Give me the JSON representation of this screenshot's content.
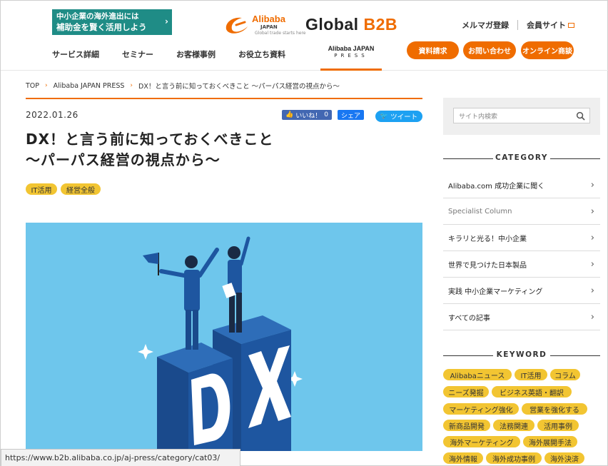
{
  "header": {
    "promo_line1": "中小企業の海外進出には",
    "promo_line2": "補助金を賢く活用しよう",
    "logo_alibaba": "Alibaba",
    "logo_japan": "JAPAN",
    "logo_tagline": "Global trade starts here",
    "logo_global": "Global",
    "logo_b2b": "B2B",
    "newsletter": "メルマガ登録",
    "members": "会員サイト",
    "nav": [
      "サービス詳細",
      "セミナー",
      "お客様事例",
      "お役立ち資料"
    ],
    "press_top": "Alibaba JAPAN",
    "press_bottom": "PRESS",
    "cta": [
      "資料請求",
      "お問い合わせ",
      "オンライン商談"
    ]
  },
  "breadcrumb": [
    "TOP",
    "Alibaba JAPAN PRESS",
    "DX！と言う前に知っておくべきこと 〜パーパス経営の視点から〜"
  ],
  "article": {
    "date": "2022.01.26",
    "like_label": "いいね！",
    "like_count": "0",
    "share_label": "シェア",
    "tweet_label": "ツイート",
    "title_line1": "DX！と言う前に知っておくべきこと",
    "title_line2": "〜パーパス経営の視点から〜",
    "tags": [
      "IT活用",
      "経営全般"
    ],
    "hero_text": "DX"
  },
  "sidebar": {
    "search_placeholder": "サイト内検索",
    "category_heading": "CATEGORY",
    "categories": [
      "Alibaba.com 成功企業に聞く",
      "Specialist Column",
      "キラリと光る！中小企業",
      "世界で見つけた日本製品",
      "実践 中小企業マーケティング",
      "すべての記事"
    ],
    "keyword_heading": "KEYWORD",
    "keywords": [
      "Alibabaニュース",
      "IT活用",
      "コラム",
      "ニーズ発掘",
      "ビジネス英語・翻訳",
      "マーケティング強化",
      "営業を強化する",
      "新商品開発",
      "法務関連",
      "活用事例",
      "海外マーケティング",
      "海外展開手法",
      "海外情報",
      "海外成功事例",
      "海外決済"
    ]
  },
  "status_url": "https://www.b2b.alibaba.co.jp/aj-press/category/cat03/",
  "colors": {
    "accent": "#ef6c00",
    "promo": "#1f8c86",
    "tag": "#f2c532",
    "hero_bg": "#6ec6ec",
    "navy": "#1e56a0"
  }
}
